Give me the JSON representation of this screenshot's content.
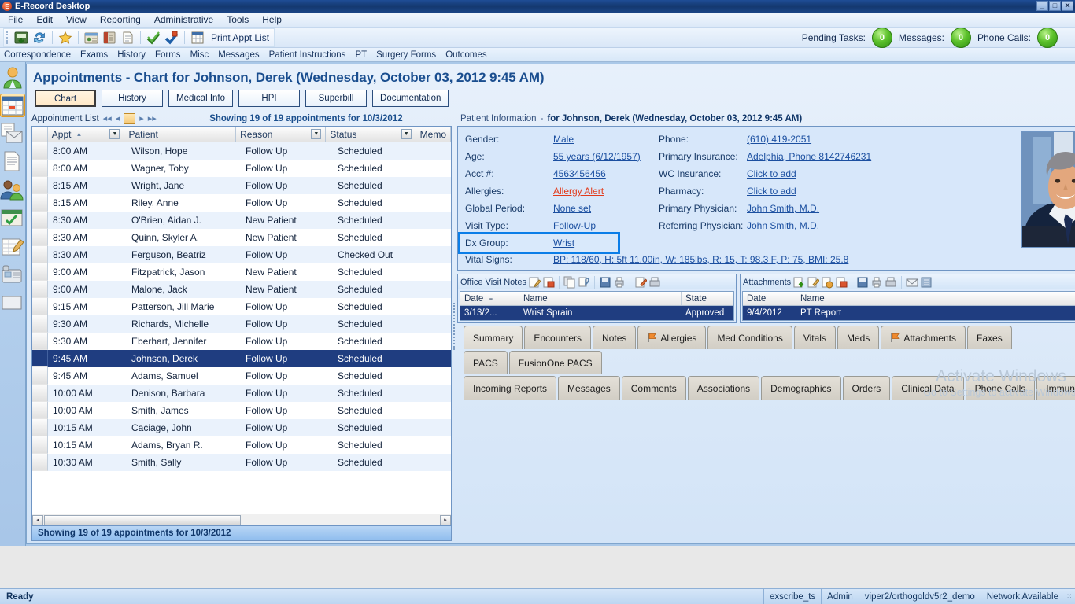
{
  "window": {
    "title": "E-Record Desktop",
    "logo_letter": "E",
    "minimize": "_",
    "maximize": "□",
    "close": "✕"
  },
  "menubar": {
    "items": [
      "File",
      "Edit",
      "View",
      "Reporting",
      "Administrative",
      "Tools",
      "Help"
    ]
  },
  "toolbar": {
    "icons": [
      "save-chart-icon",
      "refresh-icon",
      "favorites-star-icon",
      "patient-folder-icon",
      "address-book-icon",
      "new-document-icon",
      "check-in-icon",
      "check-out-icon",
      "calendar-grid-icon"
    ],
    "print_appt_list": "Print Appt List"
  },
  "counters": [
    {
      "label": "Pending Tasks:",
      "value": "0"
    },
    {
      "label": "Messages:",
      "value": "0"
    },
    {
      "label": "Phone Calls:",
      "value": "0"
    }
  ],
  "subnav": {
    "items": [
      "Correspondence",
      "Exams",
      "History",
      "Forms",
      "Misc",
      "Messages",
      "Patient Instructions",
      "PT",
      "Surgery Forms",
      "Outcomes"
    ]
  },
  "rail": {
    "items": [
      {
        "name": "patient-icon",
        "selected": false
      },
      {
        "name": "calendar-icon",
        "selected": true
      },
      {
        "name": "mail-documents-icon",
        "selected": false
      },
      {
        "name": "document-icon",
        "selected": false
      },
      {
        "name": "contacts-icon",
        "selected": false
      },
      {
        "name": "tasks-folder-icon",
        "selected": false
      },
      {
        "name": "notes-edit-icon",
        "selected": false
      },
      {
        "name": "phone-icon",
        "selected": false
      },
      {
        "name": "reports-icon",
        "selected": false
      }
    ]
  },
  "page": {
    "title": "Appointments - Chart for Johnson, Derek (Wednesday, October 03, 2012 9:45 AM)",
    "tabs": [
      {
        "label": "Chart",
        "active": true
      },
      {
        "label": "History",
        "active": false
      },
      {
        "label": "Medical Info",
        "active": false
      },
      {
        "label": "HPI",
        "active": false
      },
      {
        "label": "Superbill",
        "active": false
      },
      {
        "label": "Documentation",
        "active": false
      }
    ]
  },
  "appointment_list": {
    "header_label": "Appointment List",
    "nav_buttons": [
      "first-page-icon",
      "previous-page-icon",
      "calendar-picker-icon",
      "next-page-icon",
      "last-page-icon"
    ],
    "showing_text": "Showing 19 of 19 appointments for 10/3/2012",
    "footer_text": "Showing 19 of 19 appointments for 10/3/2012",
    "columns": [
      "Appt",
      "Patient",
      "Reason",
      "Status",
      "Memo"
    ],
    "sort_column": "Appt",
    "sort_direction": "ascending",
    "rows": [
      {
        "appt": "8:00 AM",
        "patient": "Wilson, Hope",
        "reason": "Follow Up",
        "status": "Scheduled",
        "memo": ""
      },
      {
        "appt": "8:00 AM",
        "patient": "Wagner, Toby",
        "reason": "Follow Up",
        "status": "Scheduled",
        "memo": ""
      },
      {
        "appt": "8:15 AM",
        "patient": "Wright, Jane",
        "reason": "Follow Up",
        "status": "Scheduled",
        "memo": ""
      },
      {
        "appt": "8:15 AM",
        "patient": "Riley, Anne",
        "reason": "Follow Up",
        "status": "Scheduled",
        "memo": ""
      },
      {
        "appt": "8:30 AM",
        "patient": "O'Brien, Aidan J.",
        "reason": "New Patient",
        "status": "Scheduled",
        "memo": ""
      },
      {
        "appt": "8:30 AM",
        "patient": "Quinn, Skyler A.",
        "reason": "New Patient",
        "status": "Scheduled",
        "memo": ""
      },
      {
        "appt": "8:30 AM",
        "patient": "Ferguson, Beatriz",
        "reason": "Follow Up",
        "status": "Checked Out",
        "memo": ""
      },
      {
        "appt": "9:00 AM",
        "patient": "Fitzpatrick, Jason",
        "reason": "New Patient",
        "status": "Scheduled",
        "memo": ""
      },
      {
        "appt": "9:00 AM",
        "patient": "Malone, Jack",
        "reason": "New Patient",
        "status": "Scheduled",
        "memo": ""
      },
      {
        "appt": "9:15 AM",
        "patient": "Patterson, Jill Marie",
        "reason": "Follow Up",
        "status": "Scheduled",
        "memo": ""
      },
      {
        "appt": "9:30 AM",
        "patient": "Richards, Michelle",
        "reason": "Follow Up",
        "status": "Scheduled",
        "memo": ""
      },
      {
        "appt": "9:30 AM",
        "patient": "Eberhart, Jennifer",
        "reason": "Follow Up",
        "status": "Scheduled",
        "memo": ""
      },
      {
        "appt": "9:45 AM",
        "patient": "Johnson, Derek",
        "reason": "Follow Up",
        "status": "Scheduled",
        "memo": "",
        "selected": true
      },
      {
        "appt": "9:45 AM",
        "patient": "Adams, Samuel",
        "reason": "Follow Up",
        "status": "Scheduled",
        "memo": ""
      },
      {
        "appt": "10:00 AM",
        "patient": "Denison, Barbara",
        "reason": "Follow Up",
        "status": "Scheduled",
        "memo": ""
      },
      {
        "appt": "10:00 AM",
        "patient": "Smith, James",
        "reason": "Follow Up",
        "status": "Scheduled",
        "memo": ""
      },
      {
        "appt": "10:15 AM",
        "patient": "Caciage, John",
        "reason": "Follow Up",
        "status": "Scheduled",
        "memo": ""
      },
      {
        "appt": "10:15 AM",
        "patient": "Adams, Bryan R.",
        "reason": "Follow Up",
        "status": "Scheduled",
        "memo": ""
      },
      {
        "appt": "10:30 AM",
        "patient": "Smith, Sally",
        "reason": "Follow Up",
        "status": "Scheduled",
        "memo": ""
      }
    ]
  },
  "patient_information": {
    "panel_label": "Patient Information",
    "separator": "-",
    "subject": "for Johnson, Derek (Wednesday, October 03, 2012 9:45 AM)",
    "left_fields": [
      {
        "label": "Gender:",
        "value": "Male"
      },
      {
        "label": "Age:",
        "value": "55 years (6/12/1957)"
      },
      {
        "label": "Acct #:",
        "value": "4563456456"
      },
      {
        "label": "Allergies:",
        "value": "Allergy Alert",
        "alert": true
      },
      {
        "label": "Global Period:",
        "value": "None set"
      },
      {
        "label": "Visit Type:",
        "value": "Follow-Up"
      },
      {
        "label": "Dx Group:",
        "value": "Wrist",
        "highlighted": true
      }
    ],
    "right_fields": [
      {
        "label": "Phone:",
        "value": "(610) 419-2051"
      },
      {
        "label": "Primary Insurance:",
        "value": "Adelphia, Phone 8142746231"
      },
      {
        "label": "WC Insurance:",
        "value": "Click to add"
      },
      {
        "label": "Pharmacy:",
        "value": "Click to add"
      },
      {
        "label": "Primary Physician:",
        "value": "John Smith, M.D."
      },
      {
        "label": "Referring Physician:",
        "value": "John Smith, M.D."
      }
    ],
    "vital_signs": {
      "label": "Vital Signs:",
      "value": "BP: 118/60, H: 5ft 11.00in, W: 185lbs, R: 15, T: 98.3 F, P: 75, BMI: 25.8"
    },
    "photo_alt": "patient-photo"
  },
  "office_visit_notes": {
    "title": "Office Visit Notes",
    "icons": [
      "edit-note-icon",
      "close-note-icon",
      "copy-note-icon",
      "attach-note-icon",
      "save-note-icon",
      "print-note-icon",
      "sign-note-icon",
      "fax-note-icon"
    ],
    "columns": [
      "Date",
      "Name",
      "State"
    ],
    "rows": [
      {
        "date": "3/13/2...",
        "name": "Wrist Sprain",
        "state": "Approved",
        "selected": true
      }
    ]
  },
  "attachments": {
    "title": "Attachments",
    "icons": [
      "add-attachment-icon",
      "edit-attachment-icon",
      "info-attachment-icon",
      "delete-attachment-icon",
      "save-attachment-icon",
      "print-attachment-icon",
      "fax-attachment-icon",
      "email-attachment-icon",
      "scan-attachment-icon"
    ],
    "columns": [
      "Date",
      "Name"
    ],
    "rows": [
      {
        "date": "9/4/2012",
        "name": "PT Report",
        "selected": true
      }
    ]
  },
  "bottom_tabs": {
    "row1": [
      {
        "label": "Summary",
        "active": true,
        "flag": false
      },
      {
        "label": "Encounters",
        "active": false,
        "flag": false
      },
      {
        "label": "Notes",
        "active": false,
        "flag": false
      },
      {
        "label": "Allergies",
        "active": false,
        "flag": true
      },
      {
        "label": "Med Conditions",
        "active": false,
        "flag": false
      },
      {
        "label": "Vitals",
        "active": false,
        "flag": false
      },
      {
        "label": "Meds",
        "active": false,
        "flag": false
      },
      {
        "label": "Attachments",
        "active": false,
        "flag": true
      },
      {
        "label": "Faxes",
        "active": false,
        "flag": false
      }
    ],
    "row2": [
      {
        "label": "PACS",
        "active": false,
        "flag": false
      },
      {
        "label": "FusionOne PACS",
        "active": false,
        "flag": false
      }
    ],
    "row3": [
      {
        "label": "Incoming Reports",
        "active": false,
        "flag": false
      },
      {
        "label": "Messages",
        "active": false,
        "flag": false
      },
      {
        "label": "Comments",
        "active": false,
        "flag": false
      },
      {
        "label": "Associations",
        "active": false,
        "flag": false
      },
      {
        "label": "Demographics",
        "active": false,
        "flag": false
      },
      {
        "label": "Orders",
        "active": false,
        "flag": false
      },
      {
        "label": "Clinical Data",
        "active": false,
        "flag": false
      },
      {
        "label": "Phone Calls",
        "active": false,
        "flag": false
      },
      {
        "label": "Immunizations",
        "active": false,
        "flag": false
      }
    ]
  },
  "watermark": {
    "line1": "Activate Windows",
    "line2": "Go to Settings to activate Windows."
  },
  "statusbar": {
    "ready": "Ready",
    "cells": [
      "exscribe_ts",
      "Admin",
      "viper2/orthogoldv5r2_demo",
      "Network Available"
    ]
  },
  "colors": {
    "title_blue": "#14386f",
    "accent_blue": "#1b4f8d",
    "selection_navy": "#1f3d80",
    "alert_red": "#e23a1a",
    "highlight_box": "#0b7ee8",
    "counter_green": "#5dc22c"
  }
}
